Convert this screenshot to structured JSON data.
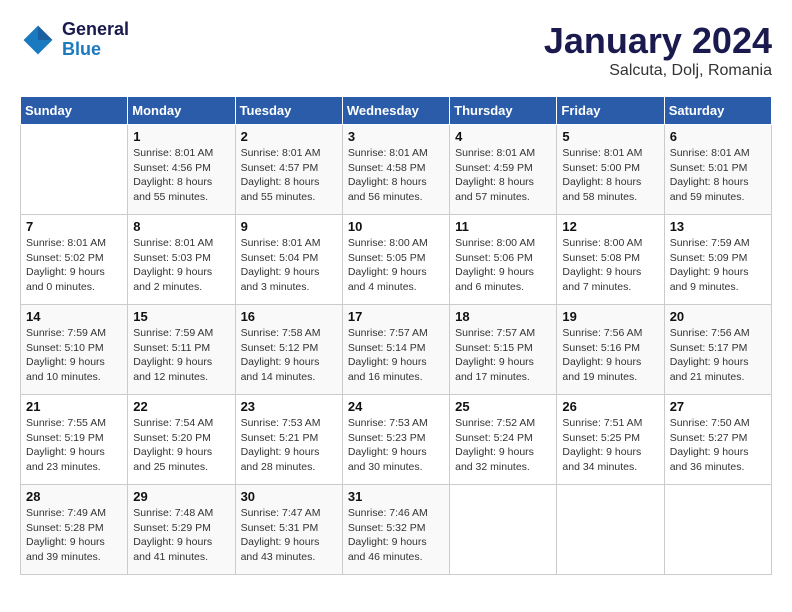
{
  "header": {
    "logo_line1": "General",
    "logo_line2": "Blue",
    "month": "January 2024",
    "location": "Salcuta, Dolj, Romania"
  },
  "days_of_week": [
    "Sunday",
    "Monday",
    "Tuesday",
    "Wednesday",
    "Thursday",
    "Friday",
    "Saturday"
  ],
  "weeks": [
    [
      {
        "day": "",
        "info": ""
      },
      {
        "day": "1",
        "info": "Sunrise: 8:01 AM\nSunset: 4:56 PM\nDaylight: 8 hours\nand 55 minutes."
      },
      {
        "day": "2",
        "info": "Sunrise: 8:01 AM\nSunset: 4:57 PM\nDaylight: 8 hours\nand 55 minutes."
      },
      {
        "day": "3",
        "info": "Sunrise: 8:01 AM\nSunset: 4:58 PM\nDaylight: 8 hours\nand 56 minutes."
      },
      {
        "day": "4",
        "info": "Sunrise: 8:01 AM\nSunset: 4:59 PM\nDaylight: 8 hours\nand 57 minutes."
      },
      {
        "day": "5",
        "info": "Sunrise: 8:01 AM\nSunset: 5:00 PM\nDaylight: 8 hours\nand 58 minutes."
      },
      {
        "day": "6",
        "info": "Sunrise: 8:01 AM\nSunset: 5:01 PM\nDaylight: 8 hours\nand 59 minutes."
      }
    ],
    [
      {
        "day": "7",
        "info": "Sunrise: 8:01 AM\nSunset: 5:02 PM\nDaylight: 9 hours\nand 0 minutes."
      },
      {
        "day": "8",
        "info": "Sunrise: 8:01 AM\nSunset: 5:03 PM\nDaylight: 9 hours\nand 2 minutes."
      },
      {
        "day": "9",
        "info": "Sunrise: 8:01 AM\nSunset: 5:04 PM\nDaylight: 9 hours\nand 3 minutes."
      },
      {
        "day": "10",
        "info": "Sunrise: 8:00 AM\nSunset: 5:05 PM\nDaylight: 9 hours\nand 4 minutes."
      },
      {
        "day": "11",
        "info": "Sunrise: 8:00 AM\nSunset: 5:06 PM\nDaylight: 9 hours\nand 6 minutes."
      },
      {
        "day": "12",
        "info": "Sunrise: 8:00 AM\nSunset: 5:08 PM\nDaylight: 9 hours\nand 7 minutes."
      },
      {
        "day": "13",
        "info": "Sunrise: 7:59 AM\nSunset: 5:09 PM\nDaylight: 9 hours\nand 9 minutes."
      }
    ],
    [
      {
        "day": "14",
        "info": "Sunrise: 7:59 AM\nSunset: 5:10 PM\nDaylight: 9 hours\nand 10 minutes."
      },
      {
        "day": "15",
        "info": "Sunrise: 7:59 AM\nSunset: 5:11 PM\nDaylight: 9 hours\nand 12 minutes."
      },
      {
        "day": "16",
        "info": "Sunrise: 7:58 AM\nSunset: 5:12 PM\nDaylight: 9 hours\nand 14 minutes."
      },
      {
        "day": "17",
        "info": "Sunrise: 7:57 AM\nSunset: 5:14 PM\nDaylight: 9 hours\nand 16 minutes."
      },
      {
        "day": "18",
        "info": "Sunrise: 7:57 AM\nSunset: 5:15 PM\nDaylight: 9 hours\nand 17 minutes."
      },
      {
        "day": "19",
        "info": "Sunrise: 7:56 AM\nSunset: 5:16 PM\nDaylight: 9 hours\nand 19 minutes."
      },
      {
        "day": "20",
        "info": "Sunrise: 7:56 AM\nSunset: 5:17 PM\nDaylight: 9 hours\nand 21 minutes."
      }
    ],
    [
      {
        "day": "21",
        "info": "Sunrise: 7:55 AM\nSunset: 5:19 PM\nDaylight: 9 hours\nand 23 minutes."
      },
      {
        "day": "22",
        "info": "Sunrise: 7:54 AM\nSunset: 5:20 PM\nDaylight: 9 hours\nand 25 minutes."
      },
      {
        "day": "23",
        "info": "Sunrise: 7:53 AM\nSunset: 5:21 PM\nDaylight: 9 hours\nand 28 minutes."
      },
      {
        "day": "24",
        "info": "Sunrise: 7:53 AM\nSunset: 5:23 PM\nDaylight: 9 hours\nand 30 minutes."
      },
      {
        "day": "25",
        "info": "Sunrise: 7:52 AM\nSunset: 5:24 PM\nDaylight: 9 hours\nand 32 minutes."
      },
      {
        "day": "26",
        "info": "Sunrise: 7:51 AM\nSunset: 5:25 PM\nDaylight: 9 hours\nand 34 minutes."
      },
      {
        "day": "27",
        "info": "Sunrise: 7:50 AM\nSunset: 5:27 PM\nDaylight: 9 hours\nand 36 minutes."
      }
    ],
    [
      {
        "day": "28",
        "info": "Sunrise: 7:49 AM\nSunset: 5:28 PM\nDaylight: 9 hours\nand 39 minutes."
      },
      {
        "day": "29",
        "info": "Sunrise: 7:48 AM\nSunset: 5:29 PM\nDaylight: 9 hours\nand 41 minutes."
      },
      {
        "day": "30",
        "info": "Sunrise: 7:47 AM\nSunset: 5:31 PM\nDaylight: 9 hours\nand 43 minutes."
      },
      {
        "day": "31",
        "info": "Sunrise: 7:46 AM\nSunset: 5:32 PM\nDaylight: 9 hours\nand 46 minutes."
      },
      {
        "day": "",
        "info": ""
      },
      {
        "day": "",
        "info": ""
      },
      {
        "day": "",
        "info": ""
      }
    ]
  ]
}
